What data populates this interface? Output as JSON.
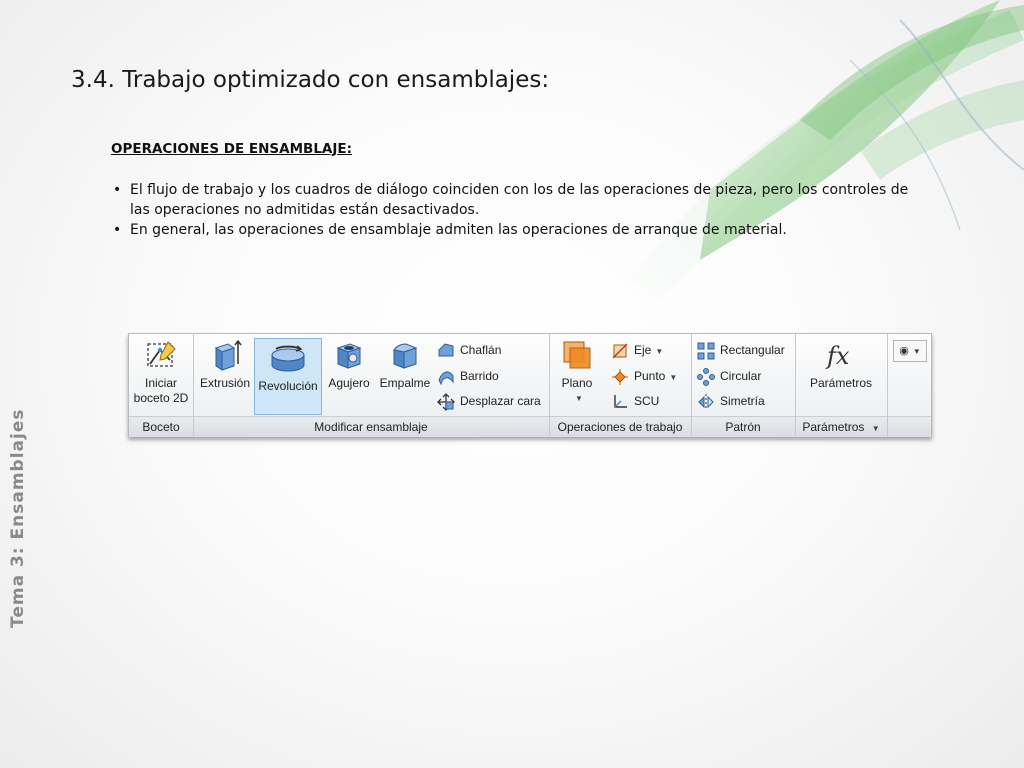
{
  "slide": {
    "title": "3.4. Trabajo optimizado con ensamblajes:",
    "subtitle": "OPERACIONES DE ENSAMBLAJE:",
    "bullets": [
      "El flujo de trabajo y los cuadros de diálogo coinciden con los de las operaciones de pieza, pero los controles de las operaciones no admitidas están desactivados.",
      "En general, las operaciones de ensamblaje admiten las operaciones de arranque de material."
    ],
    "side_label": "Tema 3: Ensamblajes"
  },
  "ribbon": {
    "groups": {
      "boceto": "Boceto",
      "modificar": "Modificar ensamblaje",
      "operaciones": "Operaciones de trabajo",
      "patron": "Patrón",
      "parametros": "Parámetros"
    },
    "buttons": {
      "iniciar_line1": "Iniciar",
      "iniciar_line2": "boceto 2D",
      "extrusion": "Extrusión",
      "revolucion": "Revolución",
      "agujero": "Agujero",
      "empalme": "Empalme",
      "chaflan": "Chaflán",
      "barrido": "Barrido",
      "desplazar": "Desplazar cara",
      "plano": "Plano",
      "eje": "Eje",
      "punto": "Punto",
      "scu": "SCU",
      "rectangular": "Rectangular",
      "circular": "Circular",
      "simetria": "Simetría",
      "parametros": "Parámetros"
    },
    "selected_button": "revolucion"
  },
  "colors": {
    "accent_blue": "#4f86c6",
    "accent_orange": "#f08a24",
    "selected_bg": "#cfe6f7"
  }
}
